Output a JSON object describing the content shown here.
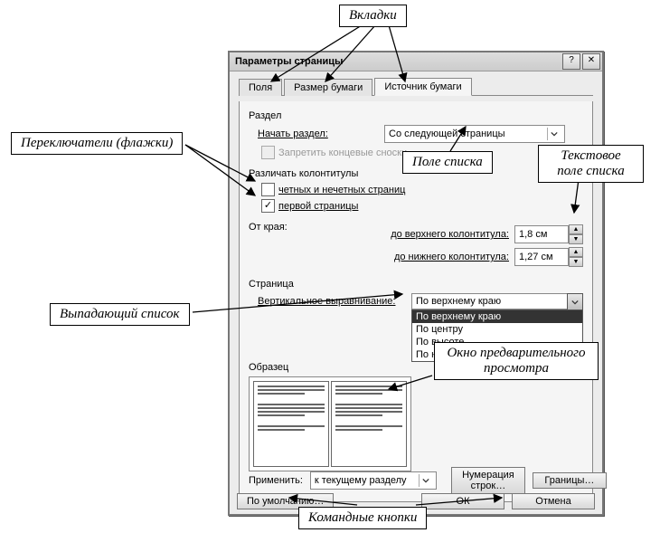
{
  "annotations": {
    "tabs": "Вкладки",
    "checkboxes": "Переключатели (флажки)",
    "listfield": "Поле списка",
    "textspin": "Текстовое поле списка",
    "dropdown": "Выпадающий список",
    "preview": "Окно предварительного просмотра",
    "cmdbtns": "Командные кнопки"
  },
  "dialog": {
    "title": "Параметры страницы",
    "help": "?",
    "close": "✕",
    "tabs": [
      "Поля",
      "Размер бумаги",
      "Источник бумаги"
    ],
    "activeTab": 2
  },
  "section": {
    "header": "Раздел",
    "start_label": "Начать раздел:",
    "start_value": "Со следующей страницы",
    "suppress_endnotes": "Запретить концевые сноски"
  },
  "headersfooters": {
    "header": "Различать колонтитулы",
    "odd_even": "четных и нечетных страниц",
    "first_page": "первой страницы"
  },
  "distance": {
    "from_edge": "От края:",
    "to_header": "до верхнего колонтитула:",
    "to_footer": "до нижнего колонтитула:",
    "header_val": "1,8 см",
    "footer_val": "1,27 см"
  },
  "page": {
    "header": "Страница",
    "valign_label": "Вертикальное выравнивание:",
    "valign_value": "По верхнему краю",
    "valign_options": [
      "По верхнему краю",
      "По центру",
      "По высоте",
      "По нижнему краю"
    ],
    "selected": 0
  },
  "sample_header": "Образец",
  "apply": {
    "label": "Применить:",
    "value": "к текущему разделу",
    "line_numbers": "Нумерация строк…",
    "borders": "Границы…"
  },
  "buttons": {
    "default": "По умолчанию…",
    "ok": "ОК",
    "cancel": "Отмена"
  }
}
